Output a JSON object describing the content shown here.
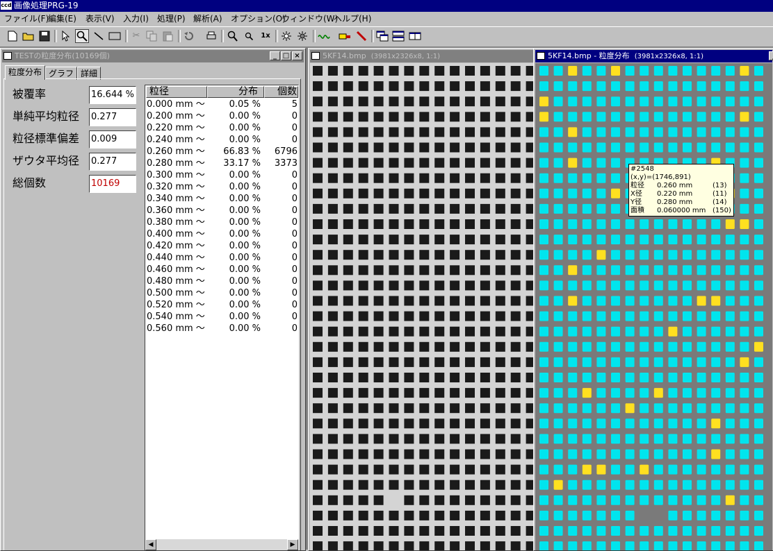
{
  "app": {
    "icon_text": "ccd",
    "title": "画像処理PRG-19"
  },
  "menu": [
    "ファイル(F)",
    "編集(E)",
    "表示(V)",
    "入力(I)",
    "処理(P)",
    "解析(A)",
    "オプション(O)",
    "ウィンドウ(W)",
    "ヘルプ(H)"
  ],
  "toolbar_icons": [
    "new-file-icon",
    "open-folder-icon",
    "save-icon",
    "pointer-icon",
    "zoom-icon",
    "line-tool-icon",
    "rectangle-tool-icon",
    "cut-icon",
    "copy-icon",
    "paste-icon",
    "undo-icon",
    "print-icon",
    "zoom-in-icon",
    "zoom-out-icon",
    "zoom-1x-icon",
    "brightness-up-icon",
    "brightness-down-icon",
    "wave-filter-icon",
    "color-tool-icon",
    "pen-icon",
    "cascade-windows-icon",
    "tile-horizontal-icon",
    "tile-vertical-icon"
  ],
  "toolbar_labels": {
    "zoom_1x": "1x"
  },
  "analysis_window": {
    "title": "TESTの粒度分布(10169個)",
    "buttons": {
      "minimize": "_",
      "maximize": "□",
      "close": "×"
    },
    "tabs": [
      "粒度分布",
      "グラフ",
      "詳細"
    ],
    "stats": [
      {
        "label": "被覆率",
        "value": "16.644 %"
      },
      {
        "label": "単純平均粒径",
        "value": "0.277"
      },
      {
        "label": "粒径標準偏差",
        "value": "0.009"
      },
      {
        "label": "ザウタ平均径",
        "value": "0.277"
      },
      {
        "label": "総個数",
        "value": "10169",
        "color": "#c00000"
      }
    ],
    "table": {
      "headers": [
        "粒径",
        "分布",
        "個数"
      ],
      "rows": [
        [
          "0.000 mm 〜",
          "0.05 %",
          "5"
        ],
        [
          "0.200 mm 〜",
          "0.00 %",
          "0"
        ],
        [
          "0.220 mm 〜",
          "0.00 %",
          "0"
        ],
        [
          "0.240 mm 〜",
          "0.00 %",
          "0"
        ],
        [
          "0.260 mm 〜",
          "66.83 %",
          "6796"
        ],
        [
          "0.280 mm 〜",
          "33.17 %",
          "3373"
        ],
        [
          "0.300 mm 〜",
          "0.00 %",
          "0"
        ],
        [
          "0.320 mm 〜",
          "0.00 %",
          "0"
        ],
        [
          "0.340 mm 〜",
          "0.00 %",
          "0"
        ],
        [
          "0.360 mm 〜",
          "0.00 %",
          "0"
        ],
        [
          "0.380 mm 〜",
          "0.00 %",
          "0"
        ],
        [
          "0.400 mm 〜",
          "0.00 %",
          "0"
        ],
        [
          "0.420 mm 〜",
          "0.00 %",
          "0"
        ],
        [
          "0.440 mm 〜",
          "0.00 %",
          "0"
        ],
        [
          "0.460 mm 〜",
          "0.00 %",
          "0"
        ],
        [
          "0.480 mm 〜",
          "0.00 %",
          "0"
        ],
        [
          "0.500 mm 〜",
          "0.00 %",
          "0"
        ],
        [
          "0.520 mm 〜",
          "0.00 %",
          "0"
        ],
        [
          "0.540 mm 〜",
          "0.00 %",
          "0"
        ],
        [
          "0.560 mm 〜",
          "0.00 %",
          "0"
        ]
      ]
    }
  },
  "image_window": {
    "title": "5KF14.bmp",
    "info": "(3981x2326x8, 1:1)"
  },
  "result_window": {
    "title": "5KF14.bmp - 粒度分布",
    "info": "(3981x2326x8, 1:1)"
  },
  "tooltip": {
    "id": "#2548",
    "coords": "(x,y)=(1746,891)",
    "rows": [
      {
        "label": "粒径",
        "value": "0.260 mm",
        "count": "(13)"
      },
      {
        "label": "X径",
        "value": "0.220 mm",
        "count": "(11)"
      },
      {
        "label": "Y径",
        "value": "0.280 mm",
        "count": "(14)"
      },
      {
        "label": "面積",
        "value": "0.060000 mm",
        "count": "(150)"
      }
    ]
  },
  "colors": {
    "particle_normal": "#00e5ee",
    "particle_highlight": "#ffe020",
    "background_gray": "#7a7a7a",
    "image_light": "#d4d4d4",
    "image_dark": "#1a1a1a"
  }
}
